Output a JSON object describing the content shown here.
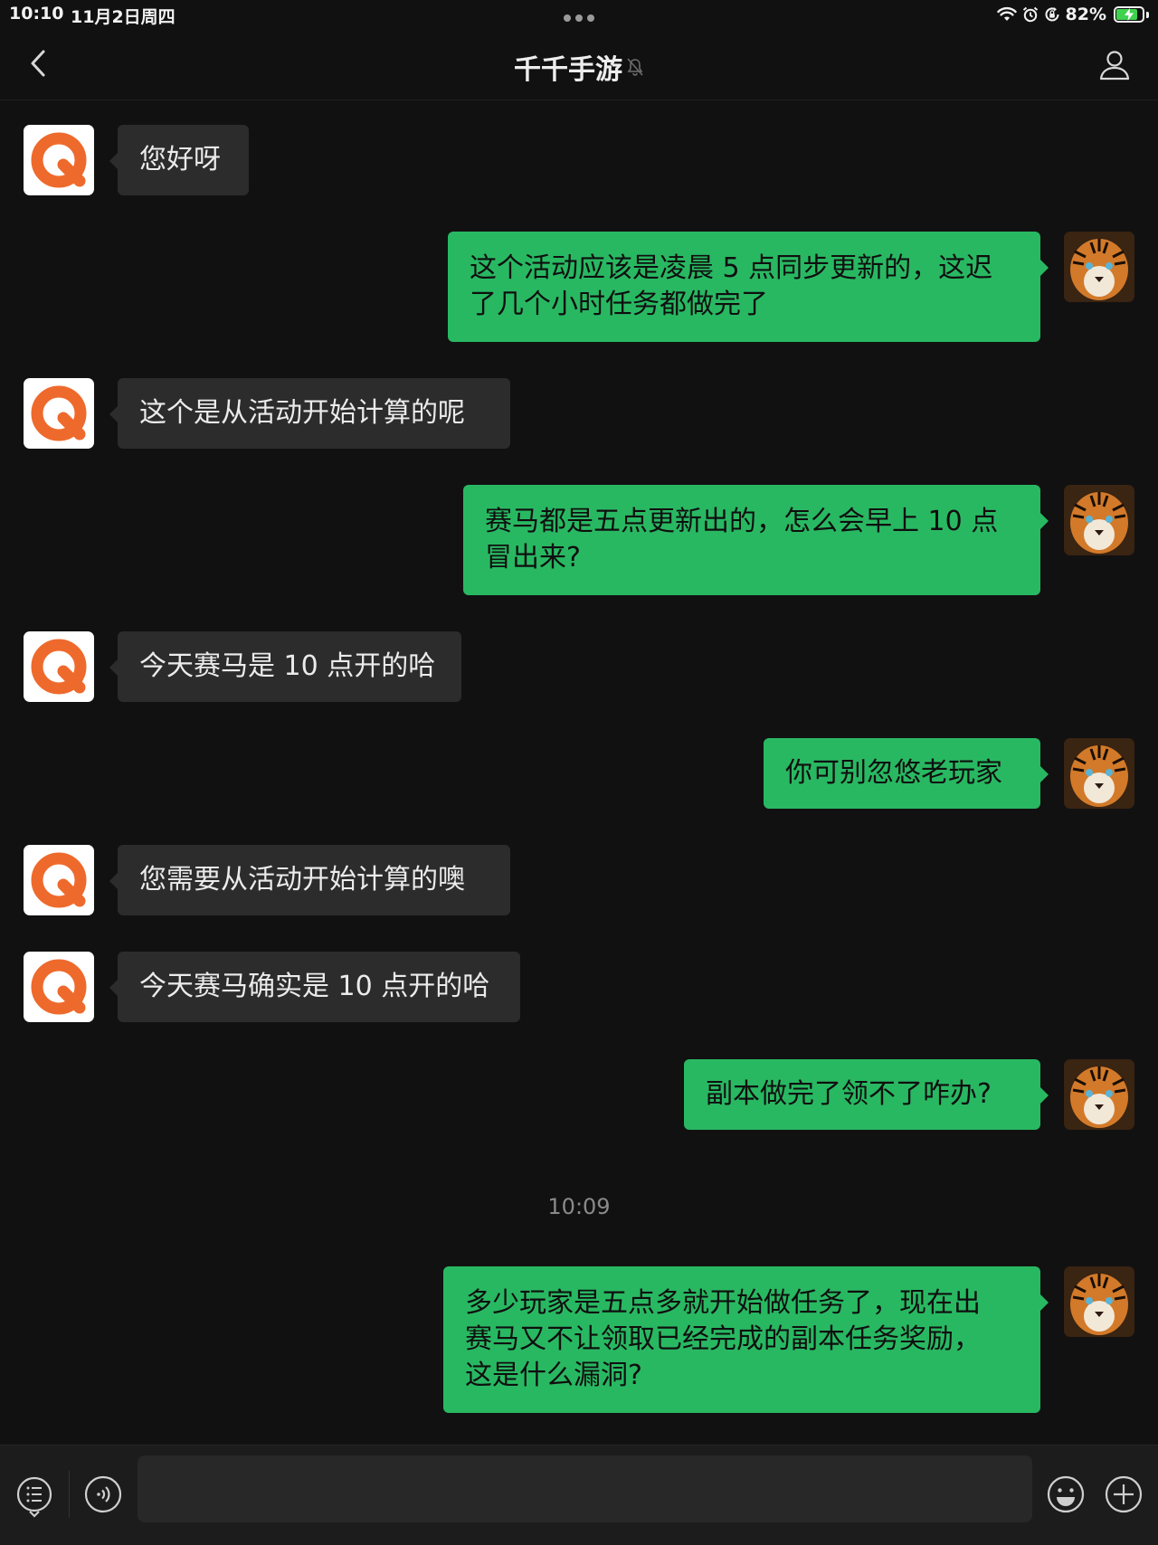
{
  "status_bar": {
    "time": "10:10",
    "date": "11月2日周四",
    "battery_percent": "82%",
    "battery_level": 0.82
  },
  "nav": {
    "title": "千千手游"
  },
  "messages": [
    {
      "side": "in",
      "text": "您好呀"
    },
    {
      "side": "out",
      "text": "这个活动应该是凌晨 5 点同步更新的，这迟\n了几个小时任务都做完了"
    },
    {
      "side": "in",
      "text": "这个是从活动开始计算的呢"
    },
    {
      "side": "out",
      "text": "赛马都是五点更新出的，怎么会早上 10 点\n冒出来?"
    },
    {
      "side": "in",
      "text": "今天赛马是 10 点开的哈"
    },
    {
      "side": "out",
      "text": "你可别忽悠老玩家"
    },
    {
      "side": "in",
      "text": "您需要从活动开始计算的噢"
    },
    {
      "side": "in",
      "text": "今天赛马确实是 10 点开的哈"
    },
    {
      "side": "out",
      "text": "副本做完了领不了咋办?"
    },
    {
      "side": "out",
      "text": "多少玩家是五点多就开始做任务了，现在出\n赛马又不让领取已经完成的副本任务奖励，\n这是什么漏洞?"
    }
  ],
  "time_divider": "10:09",
  "composer": {
    "input_value": "",
    "icons": [
      "menu-list-icon",
      "voice-icon",
      "emoji-icon",
      "plus-icon"
    ]
  },
  "colors": {
    "background": "#111111",
    "incoming_bubble": "#2c2c2c",
    "outgoing_bubble": "#29b862",
    "brand_orange": "#ee6a2c"
  }
}
